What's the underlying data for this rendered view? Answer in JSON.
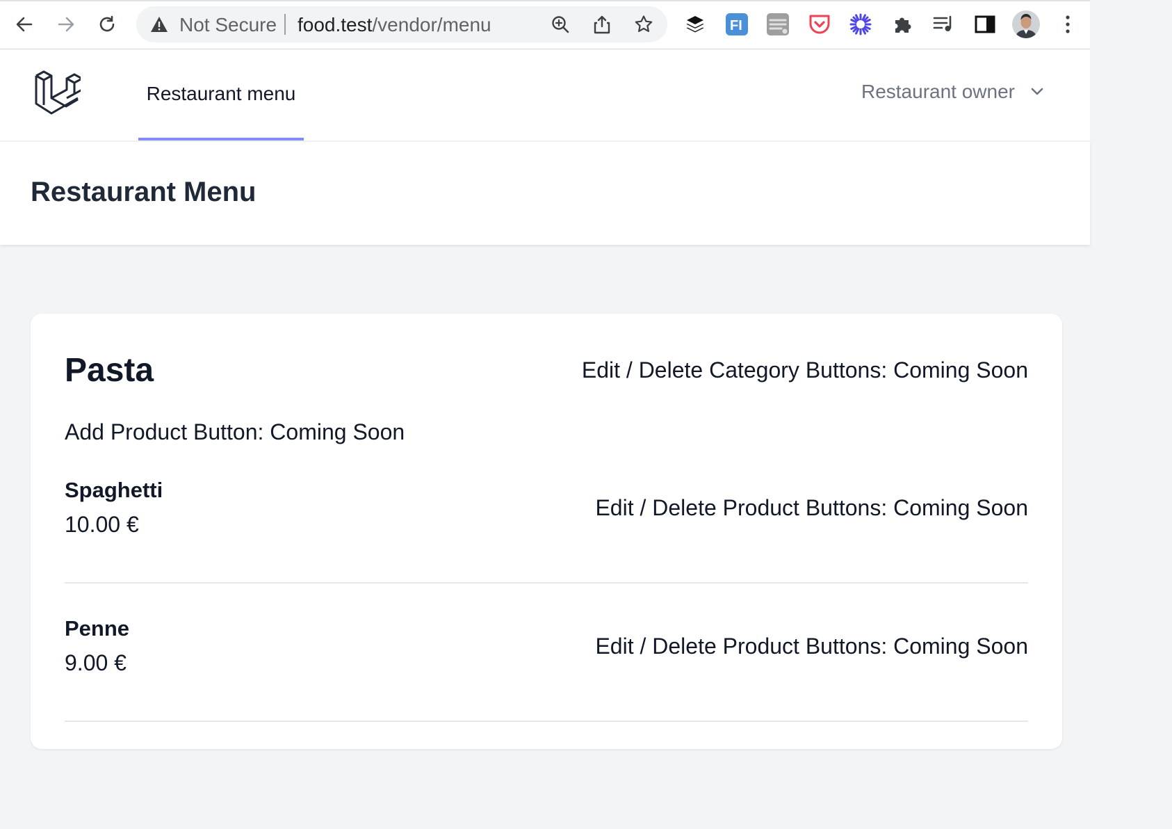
{
  "browser": {
    "security_label": "Not Secure",
    "url_host": "food.test",
    "url_path": "/vendor/menu",
    "extension_icons": [
      "buffer-icon",
      "fi-extension-icon",
      "stack-extension-icon",
      "pocket-icon",
      "asterisk-extension-icon",
      "puzzle-icon",
      "media-queue-icon",
      "side-panel-icon",
      "profile-avatar",
      "kebab-menu-icon"
    ]
  },
  "app": {
    "nav_link": "Restaurant menu",
    "user_name": "Restaurant owner"
  },
  "page": {
    "title": "Restaurant Menu"
  },
  "category": {
    "name": "Pasta",
    "actions_placeholder": "Edit / Delete Category Buttons: Coming Soon",
    "add_product_placeholder": "Add Product Button: Coming Soon",
    "products": [
      {
        "name": "Spaghetti",
        "price": "10.00 €",
        "actions_placeholder": "Edit / Delete Product Buttons: Coming Soon"
      },
      {
        "name": "Penne",
        "price": "9.00 €",
        "actions_placeholder": "Edit / Delete Product Buttons: Coming Soon"
      }
    ]
  },
  "colors": {
    "accent": "#818cf8",
    "page_bg": "#f3f4f6",
    "pocket": "#ef4056",
    "extension_blue": "#4a90d9",
    "asterisk_blue": "#4f46e5"
  }
}
